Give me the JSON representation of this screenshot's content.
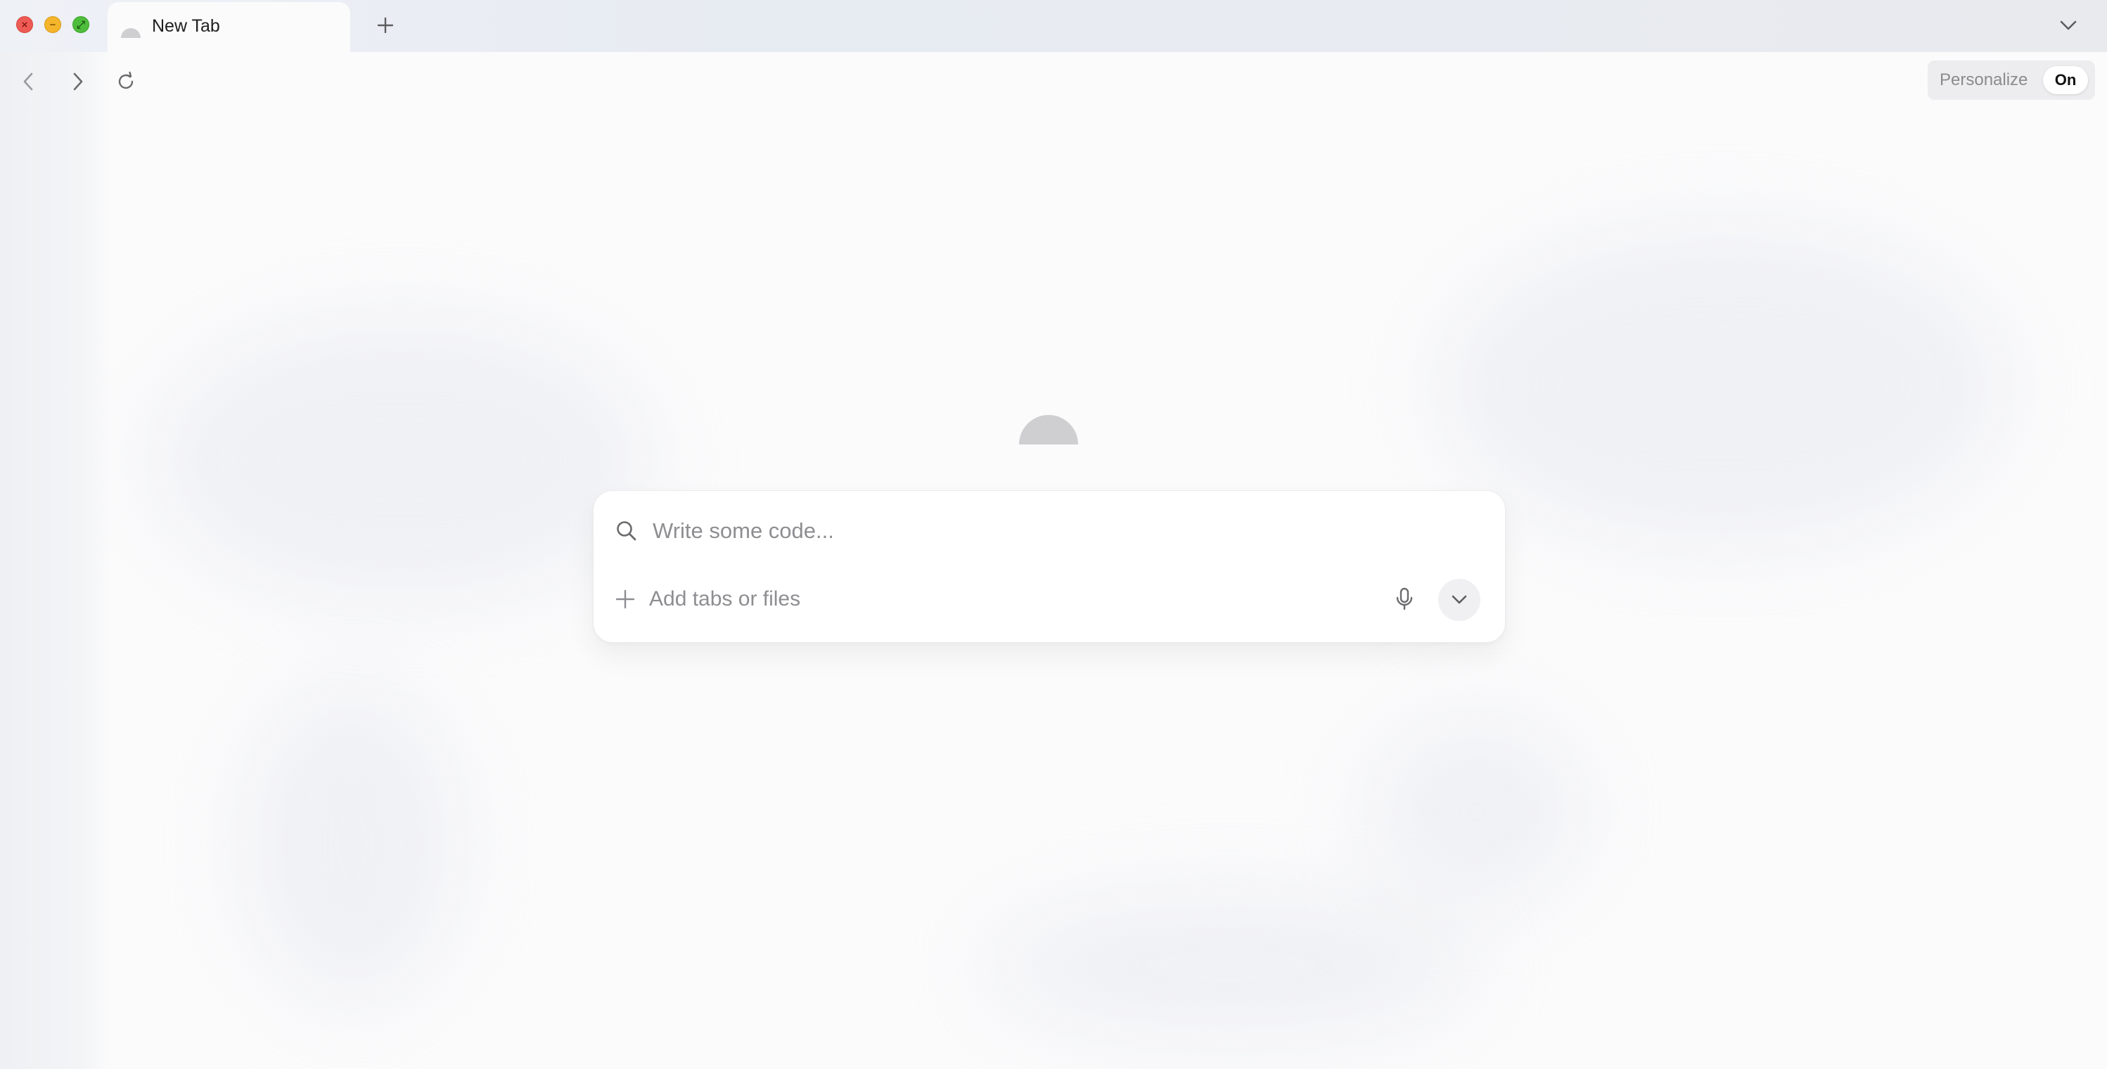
{
  "window": {
    "controls": {
      "close_glyph": "×",
      "minimize_glyph": "−",
      "maximize_glyph": "⤢"
    }
  },
  "tabs": [
    {
      "title": "New Tab",
      "favicon": "app-logo-icon",
      "active": true
    }
  ],
  "toolbar": {
    "back_icon": "chevron-left-icon",
    "forward_icon": "chevron-right-icon",
    "reload_icon": "reload-icon",
    "new_tab_icon": "plus-icon",
    "tab_list_icon": "chevron-down-icon"
  },
  "personalize": {
    "label": "Personalize",
    "state": "On"
  },
  "search": {
    "placeholder": "Write some code...",
    "value": "",
    "add_label": "Add tabs or files",
    "icons": {
      "search": "search-icon",
      "add": "plus-icon",
      "mic": "microphone-icon",
      "expand": "chevron-down-icon"
    }
  },
  "colors": {
    "close": "#ee5b55",
    "minimize": "#f4b52c",
    "maximize": "#4fbd3c",
    "placeholder_text": "#8e8e92",
    "logo": "#cfcfd2"
  }
}
